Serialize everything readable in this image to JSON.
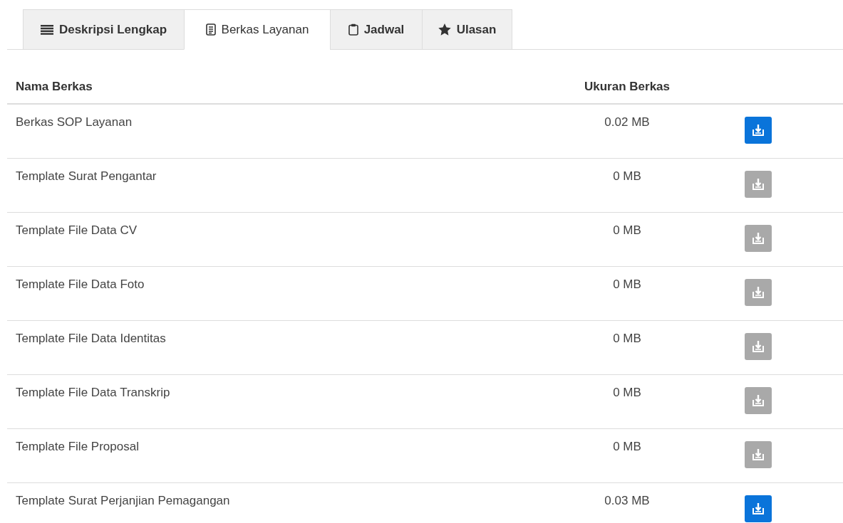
{
  "tabs": [
    {
      "label": "Deskripsi Lengkap",
      "selected": false
    },
    {
      "label": "Berkas Layanan",
      "selected": true
    },
    {
      "label": "Jadwal",
      "selected": false
    },
    {
      "label": "Ulasan",
      "selected": false
    }
  ],
  "table": {
    "columns": [
      "Nama Berkas",
      "Ukuran Berkas"
    ],
    "rows": [
      {
        "name": "Berkas SOP Layanan",
        "size": "0.02 MB",
        "disabled": false
      },
      {
        "name": "Template Surat Pengantar",
        "size": "0 MB",
        "disabled": true
      },
      {
        "name": "Template File Data CV",
        "size": "0 MB",
        "disabled": true
      },
      {
        "name": "Template File Data Foto",
        "size": "0 MB",
        "disabled": true
      },
      {
        "name": "Template File Data Identitas",
        "size": "0 MB",
        "disabled": true
      },
      {
        "name": "Template File Data Transkrip",
        "size": "0 MB",
        "disabled": true
      },
      {
        "name": "Template File Proposal",
        "size": "0 MB",
        "disabled": true
      },
      {
        "name": "Template Surat Perjanjian Pemagangan",
        "size": "0.03 MB",
        "disabled": false
      }
    ]
  }
}
